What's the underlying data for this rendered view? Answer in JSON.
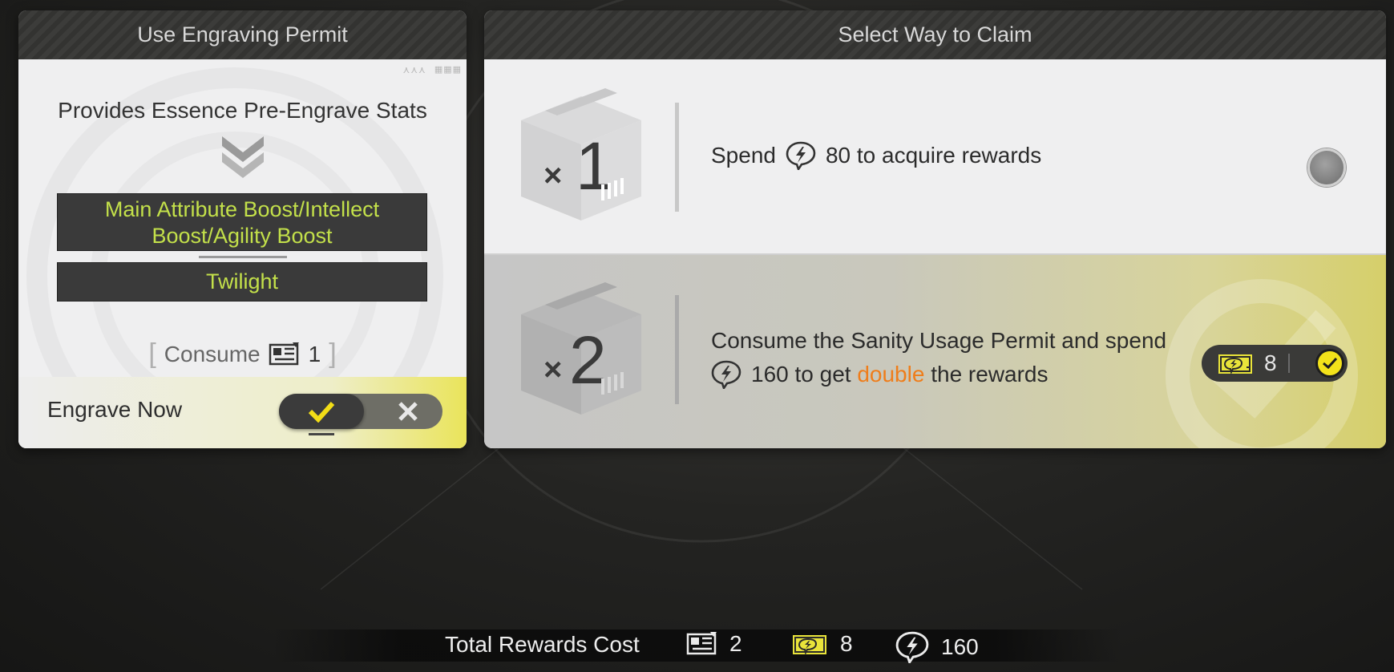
{
  "left_panel": {
    "title": "Use Engraving Permit",
    "provides_text": "Provides Essence Pre-Engrave Stats",
    "stat_main": "Main Attribute Boost/Intellect Boost/Agility Boost",
    "stat_secondary": "Twilight",
    "consume_label": "Consume",
    "consume_icon": "engraving-permit-icon",
    "consume_count": "1",
    "engrave_now_label": "Engrave Now",
    "toggle_state": "on"
  },
  "right_panel": {
    "title": "Select Way to Claim",
    "options": [
      {
        "multiplier": "1",
        "text_before": "Spend",
        "cost_icon": "sanity-icon",
        "text_after": "80 to acquire rewards",
        "selected": false
      },
      {
        "multiplier": "2",
        "line1": "Consume the Sanity Usage Permit and spend",
        "cost_icon": "sanity-icon",
        "line2_before": "160 to get",
        "line2_highlight": "double",
        "line2_after": "the rewards",
        "permit_icon": "sanity-usage-permit-icon",
        "permit_count": "8",
        "selected": true
      }
    ]
  },
  "bottom_bar": {
    "label": "Total Rewards Cost",
    "items": [
      {
        "icon": "engraving-permit-icon",
        "value": "2"
      },
      {
        "icon": "sanity-usage-permit-icon",
        "value": "8"
      },
      {
        "icon": "sanity-icon",
        "value": "160"
      }
    ]
  },
  "colors": {
    "stat_text": "#c3e04a",
    "highlight": "#ef7d1a",
    "check_yellow": "#f3e21a",
    "header_bg": "#383836"
  }
}
